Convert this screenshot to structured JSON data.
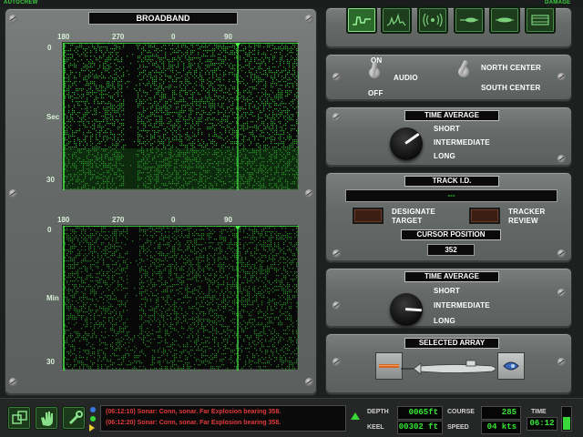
{
  "topbar": {
    "left_label": "AUTOCREW",
    "right_label": "DAMAGE"
  },
  "broadband": {
    "title": "BROADBAND",
    "bearing_ticks": [
      "180",
      "270",
      "0",
      "90"
    ],
    "top_scope": {
      "y_top": "0",
      "y_mid": "Sec",
      "y_bottom": "30"
    },
    "bottom_scope": {
      "y_top": "0",
      "y_mid": "Min",
      "y_bottom": "30"
    }
  },
  "audio_panel": {
    "on_label": "ON",
    "off_label": "OFF",
    "audio_label": "AUDIO",
    "north_label": "NORTH CENTER",
    "south_label": "SOUTH CENTER"
  },
  "time_avg_1": {
    "title": "TIME AVERAGE",
    "options": [
      "SHORT",
      "INTERMEDIATE",
      "LONG"
    ]
  },
  "track_panel": {
    "title": "TRACK I.D.",
    "track_value": "---",
    "designate_label_1": "DESIGNATE",
    "designate_label_2": "TARGET",
    "tracker_label_1": "TRACKER",
    "tracker_label_2": "REVIEW",
    "cursor_title": "CURSOR POSITION",
    "cursor_value": "352"
  },
  "time_avg_2": {
    "title": "TIME AVERAGE",
    "options": [
      "SHORT",
      "INTERMEDIATE",
      "LONG"
    ]
  },
  "array_panel": {
    "title": "SELECTED ARRAY"
  },
  "message_log": [
    "(06:12:10) Sonar: Conn, sonar. Far Explosion bearing 358.",
    "(06:12:20) Sonar: Conn, sonar. Far Explosion bearing 358."
  ],
  "status": {
    "depth_label": "DEPTH",
    "depth_value": "0065ft",
    "course_label": "COURSE",
    "course_value": "285",
    "keel_label": "KEEL",
    "keel_value": "00302 ft",
    "speed_label": "SPEED",
    "speed_value": "04 kts",
    "time_label": "TIME",
    "time_value": "06:12"
  },
  "colors": {
    "phosphor": "#37d837",
    "panel_metal": "#666a68",
    "log_text": "#e23a3a"
  }
}
